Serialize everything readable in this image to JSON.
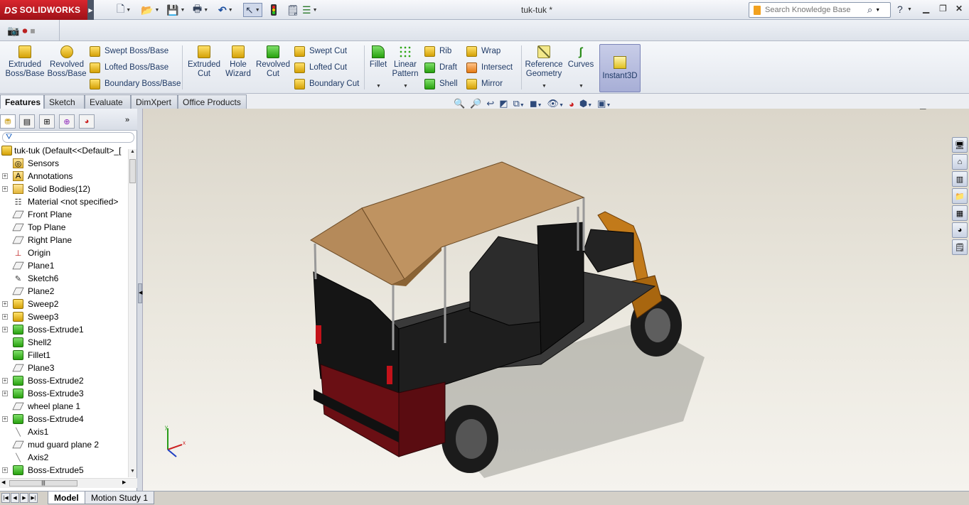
{
  "app": {
    "brand": "SOLIDWORKS",
    "brand_mark": "DS",
    "document_title": "tuk-tuk *",
    "search_placeholder": "Search Knowledge Base"
  },
  "quick_access": [
    {
      "name": "new-document-icon",
      "glyph": "🗋"
    },
    {
      "name": "open-folder-icon",
      "glyph": "📂"
    },
    {
      "name": "save-icon",
      "glyph": "💾"
    },
    {
      "name": "print-icon",
      "glyph": "🖶"
    },
    {
      "name": "undo-icon",
      "glyph": "↶"
    },
    {
      "name": "select-arrow-icon",
      "glyph": "↖"
    },
    {
      "name": "rebuild-icon",
      "glyph": "🚦"
    },
    {
      "name": "file-properties-icon",
      "glyph": "🗒"
    },
    {
      "name": "options-icon",
      "glyph": "☰"
    }
  ],
  "command_manager": {
    "big": [
      {
        "name": "extruded-boss-base-button",
        "label": "Extruded\nBoss/Base"
      },
      {
        "name": "revolved-boss-base-button",
        "label": "Revolved\nBoss/Base"
      },
      {
        "name": "extruded-cut-button",
        "label": "Extruded\nCut"
      },
      {
        "name": "hole-wizard-button",
        "label": "Hole\nWizard"
      },
      {
        "name": "revolved-cut-button",
        "label": "Revolved\nCut"
      },
      {
        "name": "fillet-button",
        "label": "Fillet"
      },
      {
        "name": "linear-pattern-button",
        "label": "Linear\nPattern"
      },
      {
        "name": "reference-geometry-button",
        "label": "Reference\nGeometry"
      },
      {
        "name": "curves-button",
        "label": "Curves"
      },
      {
        "name": "instant3d-button",
        "label": "Instant3D"
      }
    ],
    "small": [
      {
        "name": "swept-boss-base-button",
        "label": "Swept Boss/Base"
      },
      {
        "name": "lofted-boss-base-button",
        "label": "Lofted Boss/Base"
      },
      {
        "name": "boundary-boss-base-button",
        "label": "Boundary Boss/Base"
      },
      {
        "name": "swept-cut-button",
        "label": "Swept Cut"
      },
      {
        "name": "lofted-cut-button",
        "label": "Lofted Cut"
      },
      {
        "name": "boundary-cut-button",
        "label": "Boundary Cut"
      },
      {
        "name": "rib-button",
        "label": "Rib"
      },
      {
        "name": "draft-button",
        "label": "Draft"
      },
      {
        "name": "shell-button",
        "label": "Shell"
      },
      {
        "name": "wrap-button",
        "label": "Wrap"
      },
      {
        "name": "intersect-button",
        "label": "Intersect"
      },
      {
        "name": "mirror-button",
        "label": "Mirror"
      }
    ]
  },
  "tabs": [
    "Features",
    "Sketch",
    "Evaluate",
    "DimXpert",
    "Office Products"
  ],
  "active_tab": "Features",
  "feature_tree": {
    "root": "tuk-tuk  (Default<<Default>_[",
    "items": [
      {
        "label": "Sensors",
        "icon": "sensor-icon",
        "expandable": false
      },
      {
        "label": "Annotations",
        "icon": "annotations-icon",
        "expandable": true
      },
      {
        "label": "Solid Bodies(12)",
        "icon": "solid-bodies-icon",
        "expandable": true
      },
      {
        "label": "Material <not specified>",
        "icon": "material-icon",
        "expandable": false
      },
      {
        "label": "Front Plane",
        "icon": "plane-icon",
        "expandable": false
      },
      {
        "label": "Top Plane",
        "icon": "plane-icon",
        "expandable": false
      },
      {
        "label": "Right Plane",
        "icon": "plane-icon",
        "expandable": false
      },
      {
        "label": "Origin",
        "icon": "origin-icon",
        "expandable": false
      },
      {
        "label": "Plane1",
        "icon": "plane-icon",
        "expandable": false
      },
      {
        "label": "Sketch6",
        "icon": "sketch-icon",
        "expandable": false
      },
      {
        "label": "Plane2",
        "icon": "plane-icon",
        "expandable": false
      },
      {
        "label": "Sweep2",
        "icon": "sweep-icon",
        "expandable": true
      },
      {
        "label": "Sweep3",
        "icon": "sweep-icon",
        "expandable": true
      },
      {
        "label": "Boss-Extrude1",
        "icon": "extrude-icon",
        "expandable": true
      },
      {
        "label": "Shell2",
        "icon": "shell-icon",
        "expandable": false
      },
      {
        "label": "Fillet1",
        "icon": "fillet-icon",
        "expandable": false
      },
      {
        "label": "Plane3",
        "icon": "plane-icon",
        "expandable": false
      },
      {
        "label": "Boss-Extrude2",
        "icon": "extrude-icon",
        "expandable": true
      },
      {
        "label": "Boss-Extrude3",
        "icon": "extrude-icon",
        "expandable": true
      },
      {
        "label": "wheel plane 1",
        "icon": "plane-icon",
        "expandable": false
      },
      {
        "label": "Boss-Extrude4",
        "icon": "extrude-icon",
        "expandable": true
      },
      {
        "label": "Axis1",
        "icon": "axis-icon",
        "expandable": false
      },
      {
        "label": "mud guard plane 2",
        "icon": "plane-icon",
        "expandable": false
      },
      {
        "label": "Axis2",
        "icon": "axis-icon",
        "expandable": false
      },
      {
        "label": "Boss-Extrude5",
        "icon": "extrude-icon",
        "expandable": true
      }
    ]
  },
  "bottom_tabs": [
    "Model",
    "Motion Study 1"
  ],
  "colors": {
    "brand_red": "#c8102e",
    "roof_tan": "#b58a5a",
    "body_black": "#1a1a1a",
    "body_maroon": "#6a0f14",
    "handlebar_orange": "#c27a1a",
    "instant3d_active": "#a7aed6"
  }
}
